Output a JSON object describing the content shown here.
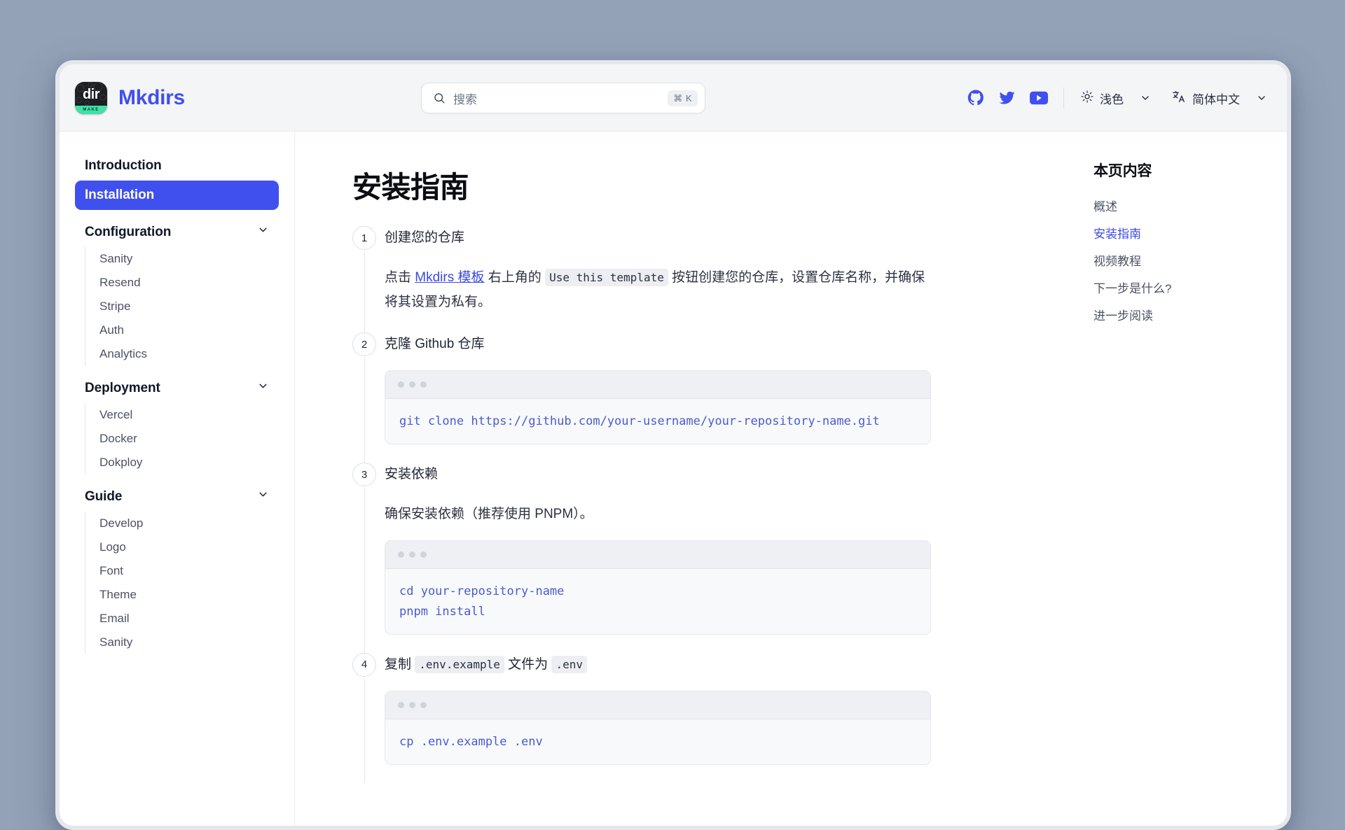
{
  "window": {
    "background_color": "#94a2b8",
    "surface_color": "#ffffff"
  },
  "header": {
    "logo": {
      "mark_text": "dir",
      "badge_text": "MAKE",
      "icon": "mkdirs-logo-icon"
    },
    "brand_name": "Mkdirs",
    "brand_color": "#4050ee",
    "search": {
      "placeholder": "搜索",
      "shortcut": "⌘ K",
      "icon": "search-icon"
    },
    "social": [
      {
        "name": "github-icon",
        "label": "GitHub"
      },
      {
        "name": "twitter-icon",
        "label": "Twitter"
      },
      {
        "name": "youtube-icon",
        "label": "YouTube"
      }
    ],
    "theme_selector": {
      "icon": "sun-icon",
      "label": "浅色",
      "chevron": "chevron-down-icon"
    },
    "language_selector": {
      "icon": "translate-icon",
      "label": "简体中文",
      "chevron": "chevron-down-icon"
    }
  },
  "sidebar": {
    "items": [
      {
        "label": "Introduction",
        "type": "link",
        "active": false
      },
      {
        "label": "Installation",
        "type": "link",
        "active": true
      }
    ],
    "groups": [
      {
        "label": "Configuration",
        "chevron": "chevron-down-icon",
        "items": [
          "Sanity",
          "Resend",
          "Stripe",
          "Auth",
          "Analytics"
        ]
      },
      {
        "label": "Deployment",
        "chevron": "chevron-down-icon",
        "items": [
          "Vercel",
          "Docker",
          "Dokploy"
        ]
      },
      {
        "label": "Guide",
        "chevron": "chevron-down-icon",
        "items": [
          "Develop",
          "Logo",
          "Font",
          "Theme",
          "Email",
          "Sanity"
        ]
      }
    ]
  },
  "main": {
    "title": "安装指南",
    "steps": [
      {
        "number": "1",
        "title": "创建您的仓库",
        "paragraph": {
          "prefix": "点击 ",
          "link": "Mkdirs 模板",
          "middle": " 右上角的 ",
          "code": "Use this template",
          "suffix": " 按钮创建您的仓库，设置仓库名称，并确保将其设置为私有。"
        }
      },
      {
        "number": "2",
        "title": "克隆 Github 仓库",
        "code": "git clone https://github.com/your-username/your-repository-name.git"
      },
      {
        "number": "3",
        "title": "安装依赖",
        "paragraph_plain": "确保安装依赖（推荐使用 PNPM）。",
        "code": "cd your-repository-name\npnpm install"
      },
      {
        "number": "4",
        "title_prefix": "复制 ",
        "title_code1": ".env.example",
        "title_middle": " 文件为 ",
        "title_code2": ".env",
        "code": "cp .env.example .env"
      }
    ]
  },
  "toc": {
    "title": "本页内容",
    "items": [
      {
        "label": "概述",
        "active": false
      },
      {
        "label": "安装指南",
        "active": true
      },
      {
        "label": "视频教程",
        "active": false
      },
      {
        "label": "下一步是什么?",
        "active": false
      },
      {
        "label": "进一步阅读",
        "active": false
      }
    ]
  }
}
